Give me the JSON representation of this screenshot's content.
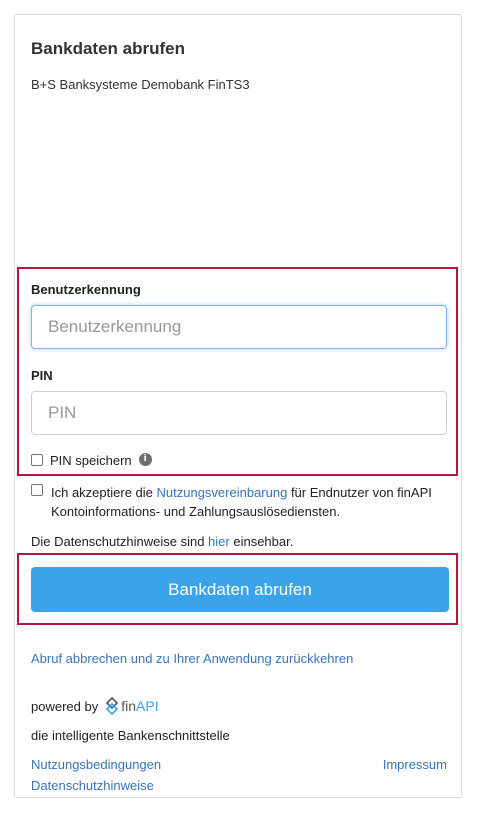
{
  "header": {
    "title": "Bankdaten abrufen",
    "bank_name": "B+S Banksysteme Demobank FinTS3"
  },
  "form": {
    "username_label": "Benutzerkennung",
    "username_placeholder": "Benutzerkennung",
    "pin_label": "PIN",
    "pin_placeholder": "PIN",
    "save_pin_label": "PIN speichern",
    "save_pin_checked": false,
    "info_icon_glyph": "i"
  },
  "terms": {
    "prefix": "Ich akzeptiere die ",
    "link": "Nutzungsvereinbarung",
    "suffix": " für Endnutzer von finAPI Kontoinformations- und Zahlungsauslösediensten.",
    "checked": false
  },
  "privacy": {
    "prefix": "Die Datenschutzhinweise sind ",
    "link": "hier",
    "suffix": " einsehbar."
  },
  "actions": {
    "submit_label": "Bankdaten abrufen",
    "abort_link": "Abruf abbrechen und zu Ihrer Anwendung zurückkehren"
  },
  "branding": {
    "powered_by": "powered by",
    "logo_text_fin": "fin",
    "logo_text_api": "API",
    "tagline": "die intelligente Bankenschnittstelle"
  },
  "footer": {
    "terms_link": "Nutzungsbedingungen",
    "privacy_link": "Datenschutzhinweise",
    "imprint_link": "Impressum"
  },
  "colors": {
    "accent": "#3aa3ea",
    "link": "#3a73b8",
    "highlight": "#b5163e"
  }
}
